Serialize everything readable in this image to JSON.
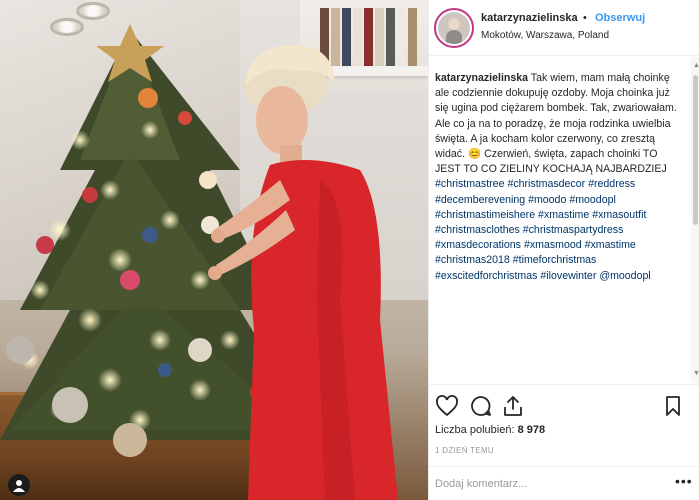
{
  "post": {
    "photo_description": "",
    "author": {
      "username": "katarzynazielinska",
      "separator": "•",
      "follow_label": "Obserwuj",
      "location": "Mokotów, Warszawa, Poland"
    },
    "caption": {
      "username": "katarzynazielinska",
      "text": " Tak wiem, mam małą choinkę ale codziennie dokupuję ozdoby. Moja choinka już się ugina pod ciężarem bombek. Tak, zwariowałam. Ale co ja na to poradzę, że moja rodzinka uwielbia święta. A ja kocham kolor czerwony, co zresztą widać. ",
      "emoji": "😊",
      "text2": " Czerwień, święta, zapach choinki TO JEST TO CO ZIELINY KOCHAJĄ NAJBARDZIEJ ",
      "hashtags": [
        "#christmastree",
        "#christmasdecor",
        "#reddress",
        "#decemberevening",
        "#moodo",
        "#moodopl",
        "#christmastimeishere",
        "#xmastime",
        "#xmasoutfit",
        "#christmasclothes",
        "#christmaspartydress",
        "#xmasdecorations",
        "#xmasmood",
        "#xmastime",
        "#christmas2018",
        "#timeforchristmas",
        "#exscitedforchristmas",
        "#ilovewinter",
        "@moodopl"
      ]
    },
    "likes_label": "Liczba polubień:",
    "likes_count": "8 978",
    "time_ago": "1 DZIEŃ TEMU",
    "comment_placeholder": "Dodaj komentarz...",
    "more_label": "•••"
  },
  "icons": {
    "like": "heart-icon",
    "comment": "comment-icon",
    "share": "share-icon",
    "save": "bookmark-icon",
    "scroll_up": "▲",
    "scroll_down": "▼"
  },
  "colors": {
    "link_blue": "#3897f0",
    "hashtag": "#003569",
    "dress_red": "#d8262b",
    "story_ring": "#c13584"
  }
}
